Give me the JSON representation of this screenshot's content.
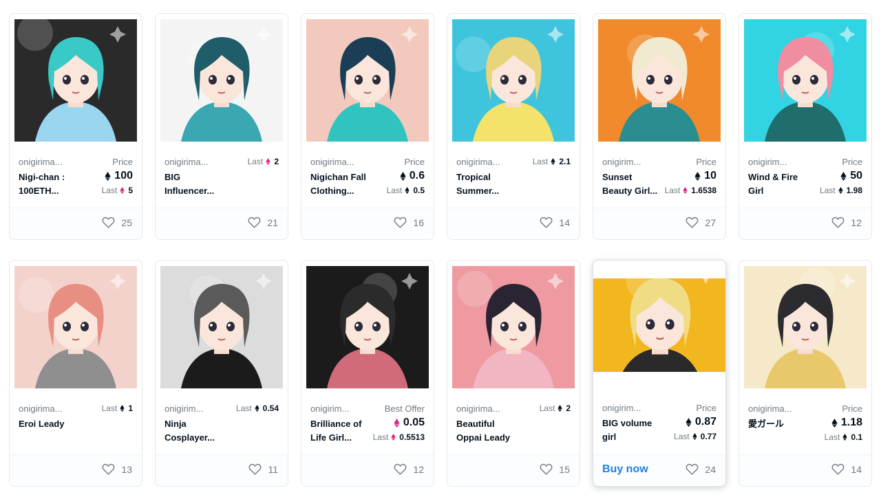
{
  "items": [
    {
      "collection": "onigirima...",
      "title_1": "Nigi-chan :",
      "title_2": "100ETH...",
      "price_label": "Price",
      "price": "100",
      "last_label": "Last",
      "last": "5",
      "last_eth_color": "#e2217e",
      "likes": "25",
      "palette": {
        "bg": "#2a2a2a",
        "hair": "#39c9c6",
        "accent": "#9ad6f0"
      }
    },
    {
      "collection": "onigirima...",
      "title_1": "BIG",
      "title_2": "Influencer...",
      "last_label": "Last",
      "last": "2",
      "last_eth_color": "#e2217e",
      "likes": "21",
      "palette": {
        "bg": "#f4f4f4",
        "hair": "#1f5d6b",
        "accent": "#3aa7b2"
      }
    },
    {
      "collection": "onigirima...",
      "title_1": "Nigichan Fall",
      "title_2": "Clothing...",
      "price_label": "Price",
      "price": "0.6",
      "last_label": "Last",
      "last": "0.5",
      "last_eth_color": "#04111d",
      "likes": "16",
      "palette": {
        "bg": "#f3c9bd",
        "hair": "#1a3e55",
        "accent": "#31c3c0"
      }
    },
    {
      "collection": "onigirima...",
      "title_1": "Tropical",
      "title_2": "Summer...",
      "last_label": "Last",
      "last": "2.1",
      "last_eth_color": "#04111d",
      "likes": "14",
      "palette": {
        "bg": "#3ec5dd",
        "hair": "#e8d47a",
        "accent": "#f3e36a"
      }
    },
    {
      "collection": "onigirim...",
      "title_1": "Sunset",
      "title_2": "Beauty Girl...",
      "price_label": "Price",
      "price": "10",
      "last_label": "Last",
      "last": "1.6538",
      "last_eth_color": "#e2217e",
      "likes": "27",
      "palette": {
        "bg": "#f08a2c",
        "hair": "#f2ead0",
        "accent": "#2a8d8f"
      }
    },
    {
      "collection": "onigirim...",
      "title_1": "Wind & Fire",
      "title_2": "Girl",
      "price_label": "Price",
      "price": "50",
      "last_label": "Last",
      "last": "1.98",
      "last_eth_color": "#04111d",
      "likes": "12",
      "palette": {
        "bg": "#32d3e3",
        "hair": "#f08da0",
        "accent": "#1f6d6d"
      }
    },
    {
      "collection": "onigirima...",
      "title_1": "Eroi Leady",
      "title_2": "",
      "last_label": "Last",
      "last": "1",
      "last_eth_color": "#04111d",
      "likes": "13",
      "palette": {
        "bg": "#f4d2cc",
        "hair": "#e88e82",
        "accent": "#8f8f8f"
      }
    },
    {
      "collection": "onigirim...",
      "title_1": "Ninja",
      "title_2": "Cosplayer...",
      "last_label": "Last",
      "last": "0.54",
      "last_eth_color": "#04111d",
      "likes": "11",
      "palette": {
        "bg": "#dcdcdc",
        "hair": "#5a5a5a",
        "accent": "#1b1b1b"
      }
    },
    {
      "collection": "onigirim...",
      "title_1": "Brilliance of",
      "title_2": "Life Girl...",
      "price_label": "Best Offer",
      "price": "0.05",
      "price_eth_color": "#e2217e",
      "last_label": "Last",
      "last": "0.5513",
      "last_eth_color": "#e2217e",
      "likes": "12",
      "palette": {
        "bg": "#1b1b1b",
        "hair": "#2b2b2b",
        "accent": "#d16b7a"
      }
    },
    {
      "collection": "onigirima...",
      "title_1": "Beautiful",
      "title_2": "Oppai Leady",
      "last_label": "Last",
      "last": "2",
      "last_eth_color": "#04111d",
      "likes": "15",
      "palette": {
        "bg": "#ee9aa0",
        "hair": "#2a2433",
        "accent": "#f2b6c2"
      }
    },
    {
      "collection": "onigirim...",
      "title_1": "BIG volume",
      "title_2": "girl",
      "price_label": "Price",
      "price": "0.87",
      "last_label": "Last",
      "last": "0.77",
      "last_eth_color": "#04111d",
      "likes": "24",
      "buy_label": "Buy now",
      "palette": {
        "bg": "#f2b71f",
        "hair": "#f0dc84",
        "accent": "#2a2a2a"
      }
    },
    {
      "collection": "onigirima...",
      "title_1": "愛ガール",
      "title_2": "",
      "price_label": "Price",
      "price": "1.18",
      "last_label": "Last",
      "last": "0.1",
      "last_eth_color": "#04111d",
      "likes": "14",
      "palette": {
        "bg": "#f5e9c9",
        "hair": "#2c2b30",
        "accent": "#e8c86a"
      }
    }
  ],
  "colors": {
    "eth_dark": "#04111d",
    "eth_pink": "#e2217e",
    "buy_blue": "#2081e2",
    "muted": "#707a83"
  },
  "icons": {
    "likes": "heart-outline-icon",
    "currency": "ethereum-icon"
  }
}
